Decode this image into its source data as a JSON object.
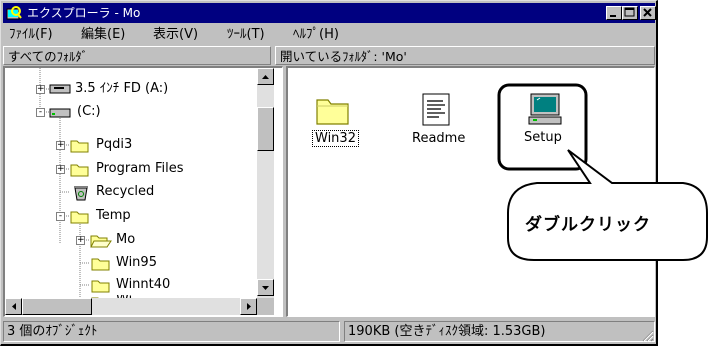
{
  "window": {
    "title": "エクスプローラ - Mo",
    "controls": [
      "minimize-icon",
      "maximize-icon",
      "close-icon"
    ]
  },
  "menu": {
    "file": "ﾌｧｲﾙ(F)",
    "edit": "編集(E)",
    "view": "表示(V)",
    "tools": "ﾂｰﾙ(T)",
    "help": "ﾍﾙﾌﾟ(H)"
  },
  "left_header": "すべてのﾌｫﾙﾀﾞ",
  "right_header": "開いているﾌｫﾙﾀﾞ: 'Mo'",
  "tree": [
    {
      "label": "3.5 ｲﾝﾁ FD (A:)",
      "icon": "floppy-drive-icon",
      "toggle": "+"
    },
    {
      "label": "(C:)",
      "icon": "hard-drive-icon",
      "toggle": "-"
    },
    {
      "label": "Pqdi3",
      "icon": "folder-icon",
      "toggle": "+"
    },
    {
      "label": "Program Files",
      "icon": "folder-icon",
      "toggle": "+"
    },
    {
      "label": "Recycled",
      "icon": "recycle-bin-icon",
      "toggle": ""
    },
    {
      "label": "Temp",
      "icon": "folder-icon",
      "toggle": "-"
    },
    {
      "label": "Mo",
      "icon": "open-folder-icon",
      "toggle": "+"
    },
    {
      "label": "Win95",
      "icon": "folder-icon",
      "toggle": ""
    },
    {
      "label": "Winnt40",
      "icon": "folder-icon",
      "toggle": ""
    },
    {
      "label": "Wi",
      "icon": "folder-icon",
      "toggle": ""
    }
  ],
  "files": [
    {
      "label": "Win32",
      "icon": "folder-icon",
      "selected": true
    },
    {
      "label": "Readme",
      "icon": "text-document-icon",
      "selected": false
    },
    {
      "label": "Setup",
      "icon": "setup-computer-icon",
      "selected": false
    }
  ],
  "callout": "ダブルクリック",
  "status": {
    "objects": "3 個のｵﾌﾞｼﾞｪｸﾄ",
    "size": "190KB (空きﾃﾞｨｽｸ領域: 1.53GB)"
  },
  "colors": {
    "titlebar": "#000080",
    "face": "#c0c0c0",
    "folder": "#ffff99",
    "setup_screen": "#008080"
  }
}
